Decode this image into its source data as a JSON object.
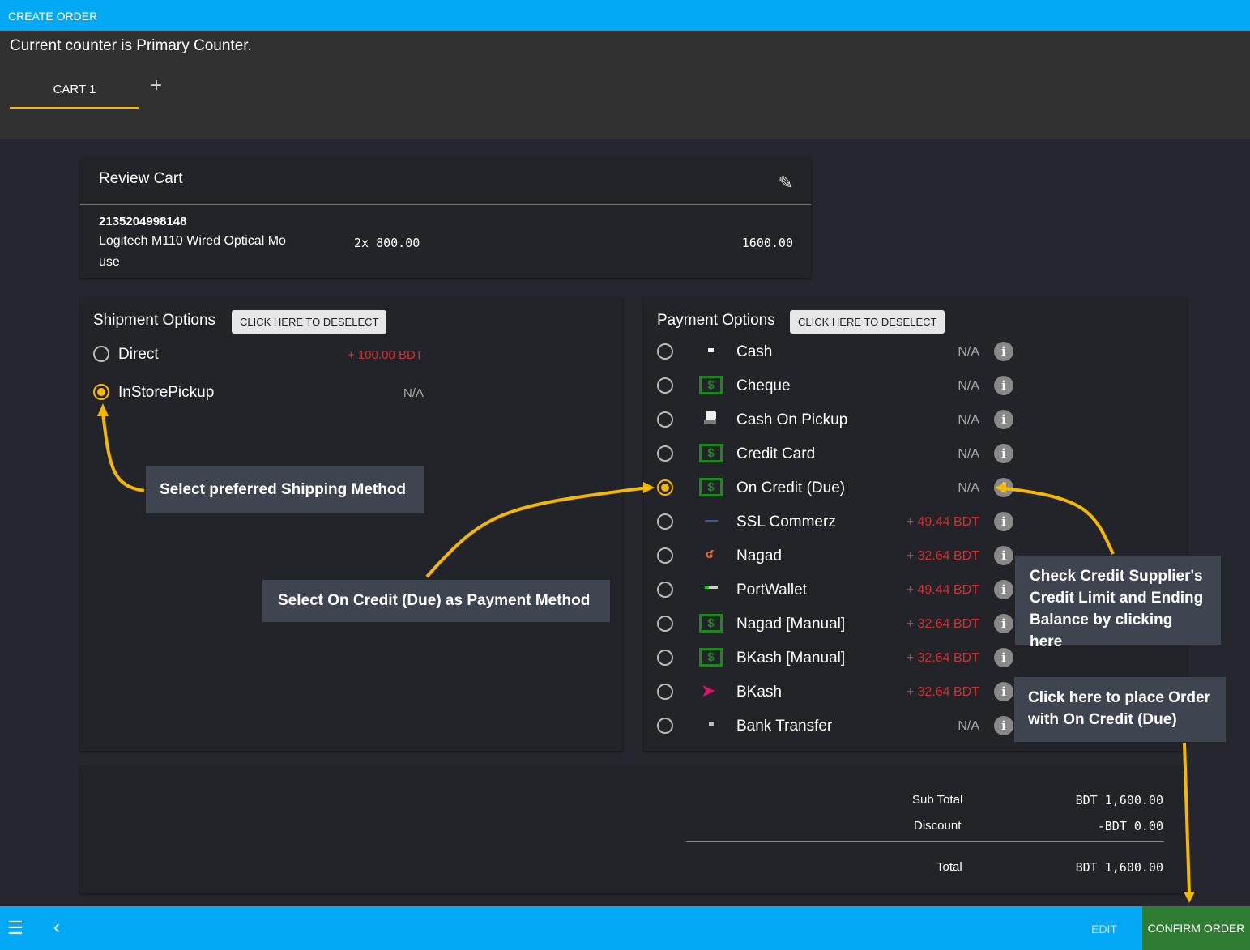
{
  "app": {
    "title": "CREATE ORDER",
    "counter_text": "Current counter is Primary Counter.",
    "tabs": [
      {
        "label": "CART 1"
      }
    ],
    "add_tab": "+"
  },
  "cart": {
    "title": "Review Cart",
    "items": [
      {
        "barcode": "2135204998148",
        "name_line1": "Logitech M110 Wired Optical Mo",
        "name_line2": "use",
        "qty_price": "2x 800.00",
        "total": "1600.00"
      }
    ]
  },
  "shipment": {
    "title": "Shipment Options",
    "deselect": "CLICK HERE TO DESELECT",
    "options": [
      {
        "label": "Direct",
        "fee": "+ 100.00 BDT",
        "selected": false
      },
      {
        "label": "InStorePickup",
        "fee": "N/A",
        "selected": true
      }
    ]
  },
  "payment": {
    "title": "Payment Options",
    "deselect": "CLICK HERE TO DESELECT",
    "options": [
      {
        "label": "Cash",
        "fee": "N/A",
        "icon": "cash-icon"
      },
      {
        "label": "Cheque",
        "fee": "N/A",
        "icon": "dollar-icon"
      },
      {
        "label": "Cash On Pickup",
        "fee": "N/A",
        "icon": "hand-cash-icon"
      },
      {
        "label": "Credit Card",
        "fee": "N/A",
        "icon": "dollar-icon"
      },
      {
        "label": "On Credit (Due)",
        "fee": "N/A",
        "icon": "dollar-icon",
        "selected": true
      },
      {
        "label": "SSL Commerz",
        "fee": "+ 49.44 BDT",
        "icon": "sslcommerz-icon"
      },
      {
        "label": "Nagad",
        "fee": "+ 32.64 BDT",
        "icon": "nagad-icon"
      },
      {
        "label": "PortWallet",
        "fee": "+ 49.44 BDT",
        "icon": "portwallet-icon"
      },
      {
        "label": "Nagad [Manual]",
        "fee": "+ 32.64 BDT",
        "icon": "dollar-icon"
      },
      {
        "label": "BKash [Manual]",
        "fee": "+ 32.64 BDT",
        "icon": "dollar-icon"
      },
      {
        "label": "BKash",
        "fee": "+ 32.64 BDT",
        "icon": "bkash-icon"
      },
      {
        "label": "Bank Transfer",
        "fee": "N/A",
        "icon": "bank-icon"
      }
    ]
  },
  "totals": {
    "subtotal_label": "Sub Total",
    "subtotal": "BDT 1,600.00",
    "discount_label": "Discount",
    "discount": "-BDT 0.00",
    "total_label": "Total",
    "total": "BDT 1,600.00"
  },
  "annotations": {
    "shipping": "Select preferred Shipping Method",
    "payment": "Select On Credit (Due) as Payment Method",
    "credit_l1": "Check Credit Supplier's",
    "credit_l2": "Credit Limit and Ending",
    "credit_l3": "Balance by clicking here",
    "confirm_l1": "Click here to place Order",
    "confirm_l2": "with On Credit (Due)"
  },
  "bottom": {
    "edit": "EDIT",
    "confirm": "CONFIRM ORDER"
  },
  "colors": {
    "primary": "#03a9f4",
    "accent": "#f5b800",
    "confirm": "#2e7d32",
    "fee_red": "#d32f2f"
  }
}
